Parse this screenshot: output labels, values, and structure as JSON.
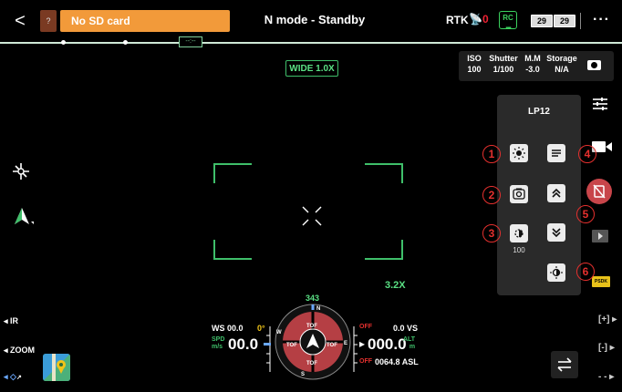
{
  "top_bar": {
    "back_label": "<",
    "warning_chip": "?",
    "status_message": "No SD card",
    "mode_title": "N mode - Standby",
    "rtk_label": "RTK",
    "rtk_satellites": "0",
    "rc_label": "RC",
    "battery_1": "29",
    "battery_2": "29",
    "more_label": "···"
  },
  "progress_marker": "--:--",
  "camera": {
    "lens_label": "WIDE 1.0X",
    "zoom_label": "3.2X"
  },
  "params": [
    {
      "label": "ISO",
      "value": "100"
    },
    {
      "label": "Shutter",
      "value": "1/100"
    },
    {
      "label": "M.M",
      "value": "-3.0"
    },
    {
      "label": "Storage",
      "value": "N/A"
    }
  ],
  "control_panel": {
    "title": "LP12",
    "brightness_value": "100"
  },
  "callouts": [
    "1",
    "2",
    "3",
    "4",
    "5",
    "6"
  ],
  "left_controls": {
    "ir_label": "IR",
    "zoom_label": "ZOOM"
  },
  "flight": {
    "ws_label": "WS 00.0",
    "speed_label": "SPD\nm/s",
    "speed_value": "00.0",
    "speed_marker": "0°",
    "heading": "343",
    "off_top": "OFF",
    "vs_value": "0.0 VS",
    "altitude_value": "000.0",
    "alt_label": "ALT",
    "alt_unit": "m",
    "off_bottom": "OFF",
    "asl_value": "0064.8 ASL",
    "tof_label": "TOF",
    "compass_letters": [
      "N",
      "E",
      "S",
      "W"
    ]
  },
  "right_controls": {
    "zoom_in": "[+]",
    "zoom_out": "[-]",
    "psdk_label": "PSDK"
  },
  "colors": {
    "accent_green": "#3fbf6a",
    "warning_orange": "#f29a3a",
    "callout_red": "#e5302e",
    "record_red": "#c8454a"
  }
}
